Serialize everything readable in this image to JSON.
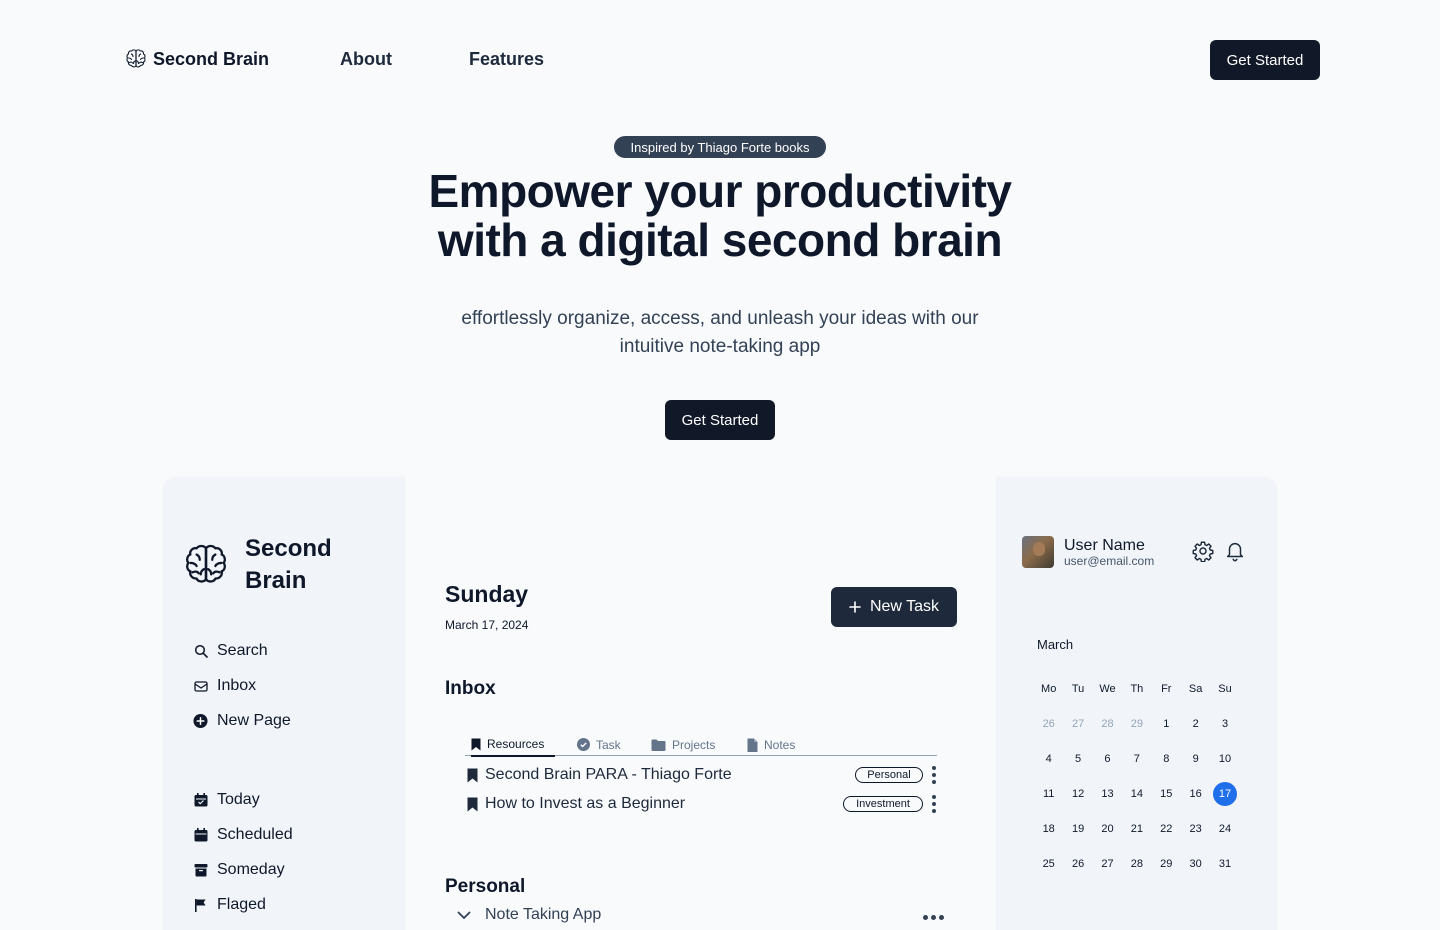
{
  "nav": {
    "brand": "Second Brain",
    "links": [
      "About",
      "Features"
    ],
    "cta": "Get Started"
  },
  "hero": {
    "badge": "Inspired by Thiago Forte books",
    "title_line1": "Empower your productivity",
    "title_line2": "with a digital second brain",
    "subtitle_line1": "effortlessly organize, access, and unleash your ideas with our",
    "subtitle_line2": "intuitive note-taking app",
    "cta": "Get Started"
  },
  "sidebar": {
    "brand_line1": "Second",
    "brand_line2": "Brain",
    "top_items": [
      {
        "label": "Search",
        "icon": "search-icon"
      },
      {
        "label": "Inbox",
        "icon": "inbox-icon"
      },
      {
        "label": "New Page",
        "icon": "plus-circle-icon"
      }
    ],
    "bottom_items": [
      {
        "label": "Today",
        "icon": "calendar-icon"
      },
      {
        "label": "Scheduled",
        "icon": "calendar-days-icon"
      },
      {
        "label": "Someday",
        "icon": "archive-icon"
      },
      {
        "label": "Flaged",
        "icon": "flag-icon"
      }
    ]
  },
  "main": {
    "day": "Sunday",
    "date": "March 17, 2024",
    "new_task": "New Task",
    "inbox_title": "Inbox",
    "tabs": [
      {
        "label": "Resources",
        "icon": "bookmark-icon",
        "active": true
      },
      {
        "label": "Task",
        "icon": "check-circle-icon",
        "active": false
      },
      {
        "label": "Projects",
        "icon": "folder-icon",
        "active": false
      },
      {
        "label": "Notes",
        "icon": "file-icon",
        "active": false
      }
    ],
    "inbox_items": [
      {
        "title": "Second Brain PARA - Thiago Forte",
        "tag": "Personal"
      },
      {
        "title": "How to Invest as a Beginner",
        "tag": "Investment"
      }
    ],
    "personal_title": "Personal",
    "personal_items": [
      {
        "title": "Note Taking App"
      }
    ]
  },
  "right": {
    "user_name": "User Name",
    "user_email": "user@email.com",
    "month": "March",
    "weekdays": [
      "Mo",
      "Tu",
      "We",
      "Th",
      "Fr",
      "Sa",
      "Su"
    ],
    "weeks": [
      [
        "26",
        "27",
        "28",
        "29",
        "1",
        "2",
        "3"
      ],
      [
        "4",
        "5",
        "6",
        "7",
        "8",
        "9",
        "10"
      ],
      [
        "11",
        "12",
        "13",
        "14",
        "15",
        "16",
        "17"
      ],
      [
        "18",
        "19",
        "20",
        "21",
        "22",
        "23",
        "24"
      ],
      [
        "25",
        "26",
        "27",
        "28",
        "29",
        "30",
        "31"
      ]
    ],
    "muted_days_first_week": 4,
    "selected_day": "17",
    "accent": "#1f6feb"
  }
}
